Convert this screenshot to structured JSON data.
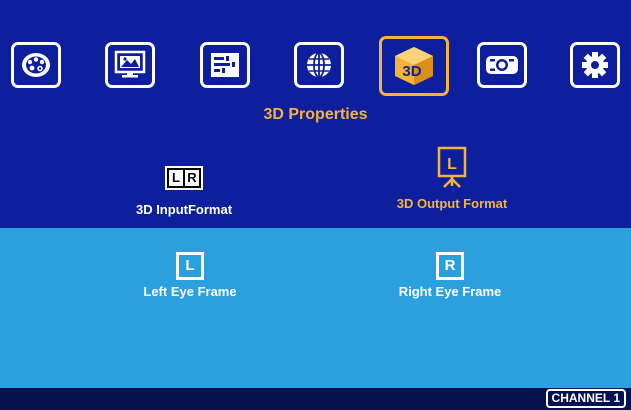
{
  "menu": {
    "tabs": [
      {
        "icon": "palette-icon"
      },
      {
        "icon": "monitor-image-icon"
      },
      {
        "icon": "adjust-sliders-icon"
      },
      {
        "icon": "globe-icon"
      },
      {
        "icon": "3d-cube-icon",
        "active": true
      },
      {
        "icon": "projector-icon"
      },
      {
        "icon": "gear-icon"
      }
    ],
    "title": "3D Properties"
  },
  "options": {
    "input_format": {
      "label": "3D InputFormat",
      "icon_left": "L",
      "icon_right": "R"
    },
    "output_format": {
      "label": "3D Output Format",
      "icon": "L",
      "selected": true
    },
    "left_eye": {
      "label": "Left Eye Frame",
      "icon": "L"
    },
    "right_eye": {
      "label": "Right Eye Frame",
      "icon": "R"
    }
  },
  "status": {
    "channel": "CHANNEL 1"
  },
  "colors": {
    "top_bg": "#0d1f9c",
    "bottom_bg": "#2aa0de",
    "accent": "#f6b33a",
    "text": "#ffffff"
  }
}
